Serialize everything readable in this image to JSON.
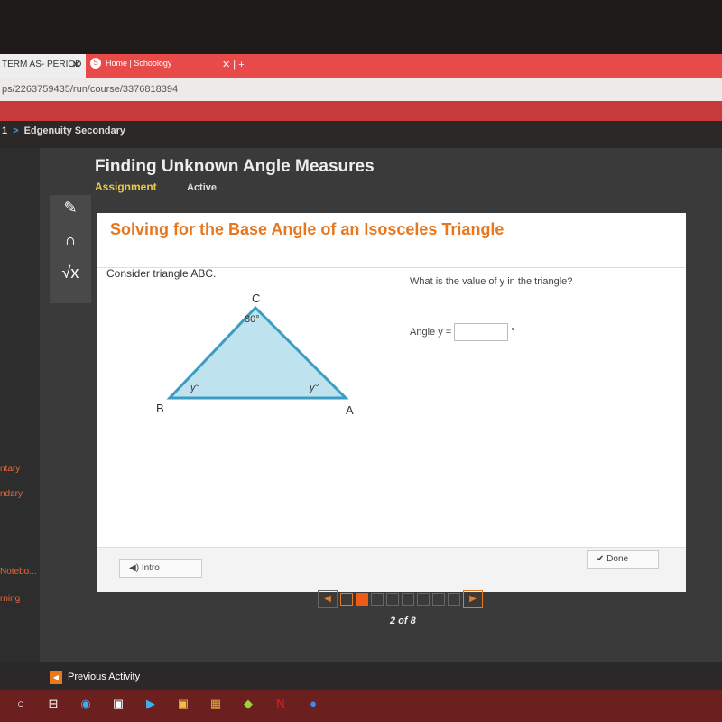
{
  "browser": {
    "tabs": [
      {
        "label": "TERM AS- PERIOD",
        "close": "✕"
      },
      {
        "label": "Home | Schoology",
        "close": "✕"
      }
    ],
    "new_tab": "+",
    "url": "ps/2263759435/run/course/3376818394"
  },
  "breadcrumb": {
    "items": [
      "1",
      "Edgenuity Secondary"
    ],
    "sep": ">"
  },
  "sidebar": {
    "labels": [
      "ntary",
      "ndary",
      "Notebo...",
      "rning"
    ]
  },
  "header": {
    "title": "Finding Unknown Angle Measures",
    "type": "Assignment",
    "status": "Active"
  },
  "tools": [
    "pencil-icon",
    "headphones-icon",
    "calculator-icon"
  ],
  "activity": {
    "title": "Solving for the Base Angle of an Isosceles Triangle",
    "prompt": "Consider triangle ABC.",
    "question": "What is the value of y in the triangle?",
    "answer_label": "Angle y =",
    "answer_value": "",
    "answer_unit": "°",
    "triangle": {
      "vertices": [
        "A",
        "B",
        "C"
      ],
      "angle_c": "80°",
      "angle_b": "y°",
      "angle_a": "y°",
      "fill": "#bfe3ee",
      "stroke": "#3b9cc4"
    },
    "intro_label": "Intro",
    "done_label": "Done"
  },
  "pager": {
    "total": 8,
    "current": 2,
    "label": "2 of 8"
  },
  "footer": {
    "prev_label": "Previous Activity"
  },
  "colors": {
    "accent": "#e8771e",
    "title_yellow": "#e6c84a"
  }
}
